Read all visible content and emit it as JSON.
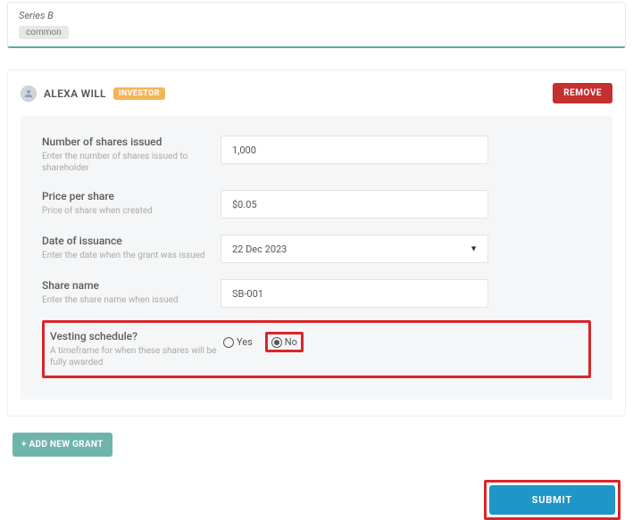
{
  "top": {
    "series": "Series B",
    "pill": "common"
  },
  "user": {
    "name": "ALEXA WILL",
    "badge": "INVESTOR"
  },
  "actions": {
    "remove": "REMOVE",
    "add_grant": "+ ADD NEW GRANT",
    "submit": "SUBMIT"
  },
  "fields": {
    "shares": {
      "label": "Number of shares issued",
      "sub": "Enter the number of shares issued to shareholder",
      "value": "1,000"
    },
    "price": {
      "label": "Price per share",
      "sub": "Price of share when created",
      "value": "$0.05"
    },
    "date": {
      "label": "Date of issuance",
      "sub": "Enter the date when the grant was issued",
      "value": "22 Dec 2023"
    },
    "shareName": {
      "label": "Share name",
      "sub": "Enter the share name when issued",
      "value": "SB-001"
    },
    "vesting": {
      "label": "Vesting schedule?",
      "sub": "A timeframe for when these shares will be fully awarded",
      "yes": "Yes",
      "no": "No",
      "selected": "no"
    }
  }
}
